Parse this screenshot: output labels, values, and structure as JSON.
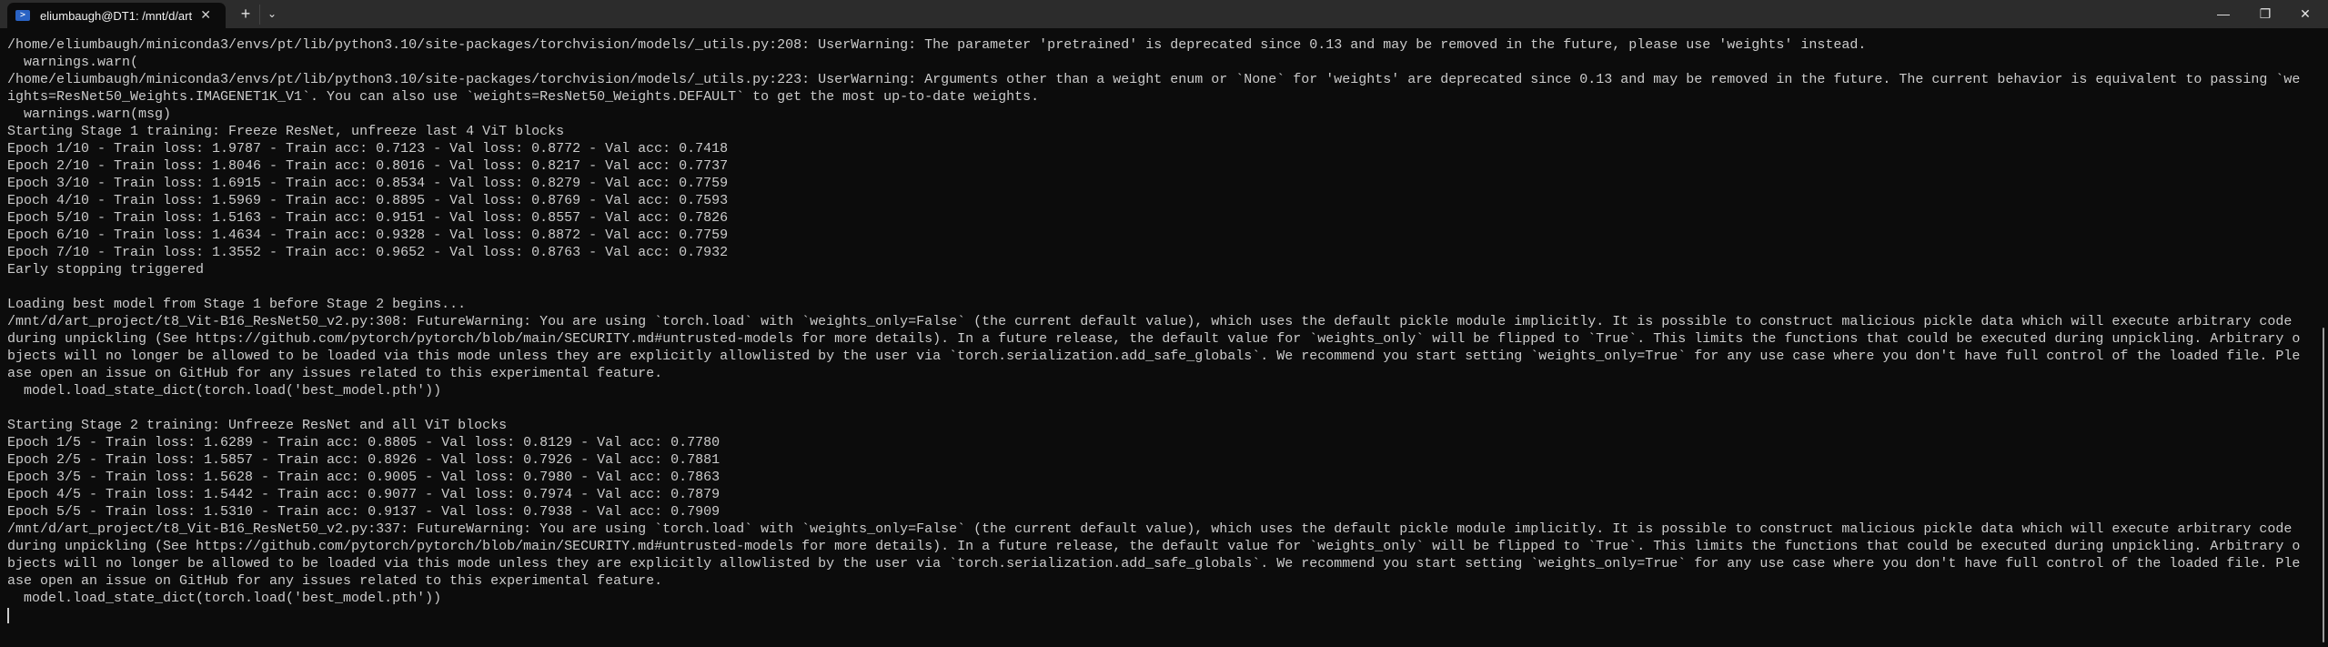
{
  "window": {
    "tab_title": "eliumbaugh@DT1: /mnt/d/art",
    "tab_icon": "powershell-icon",
    "new_tab_label": "+",
    "dropdown_label": "⌄",
    "minimize_label": "—",
    "maximize_label": "❐",
    "close_label": "✕",
    "tab_close_label": "✕"
  },
  "terminal": {
    "lines": [
      "/home/eliumbaugh/miniconda3/envs/pt/lib/python3.10/site-packages/torchvision/models/_utils.py:208: UserWarning: The parameter 'pretrained' is deprecated since 0.13 and may be removed in the future, please use 'weights' instead.",
      "  warnings.warn(",
      "/home/eliumbaugh/miniconda3/envs/pt/lib/python3.10/site-packages/torchvision/models/_utils.py:223: UserWarning: Arguments other than a weight enum or `None` for 'weights' are deprecated since 0.13 and may be removed in the future. The current behavior is equivalent to passing `we",
      "ights=ResNet50_Weights.IMAGENET1K_V1`. You can also use `weights=ResNet50_Weights.DEFAULT` to get the most up-to-date weights.",
      "  warnings.warn(msg)",
      "Starting Stage 1 training: Freeze ResNet, unfreeze last 4 ViT blocks",
      "Epoch 1/10 - Train loss: 1.9787 - Train acc: 0.7123 - Val loss: 0.8772 - Val acc: 0.7418",
      "Epoch 2/10 - Train loss: 1.8046 - Train acc: 0.8016 - Val loss: 0.8217 - Val acc: 0.7737",
      "Epoch 3/10 - Train loss: 1.6915 - Train acc: 0.8534 - Val loss: 0.8279 - Val acc: 0.7759",
      "Epoch 4/10 - Train loss: 1.5969 - Train acc: 0.8895 - Val loss: 0.8769 - Val acc: 0.7593",
      "Epoch 5/10 - Train loss: 1.5163 - Train acc: 0.9151 - Val loss: 0.8557 - Val acc: 0.7826",
      "Epoch 6/10 - Train loss: 1.4634 - Train acc: 0.9328 - Val loss: 0.8872 - Val acc: 0.7759",
      "Epoch 7/10 - Train loss: 1.3552 - Train acc: 0.9652 - Val loss: 0.8763 - Val acc: 0.7932",
      "Early stopping triggered",
      "",
      "Loading best model from Stage 1 before Stage 2 begins...",
      "/mnt/d/art_project/t8_Vit-B16_ResNet50_v2.py:308: FutureWarning: You are using `torch.load` with `weights_only=False` (the current default value), which uses the default pickle module implicitly. It is possible to construct malicious pickle data which will execute arbitrary code",
      "during unpickling (See https://github.com/pytorch/pytorch/blob/main/SECURITY.md#untrusted-models for more details). In a future release, the default value for `weights_only` will be flipped to `True`. This limits the functions that could be executed during unpickling. Arbitrary o",
      "bjects will no longer be allowed to be loaded via this mode unless they are explicitly allowlisted by the user via `torch.serialization.add_safe_globals`. We recommend you start setting `weights_only=True` for any use case where you don't have full control of the loaded file. Ple",
      "ase open an issue on GitHub for any issues related to this experimental feature.",
      "  model.load_state_dict(torch.load('best_model.pth'))",
      "",
      "Starting Stage 2 training: Unfreeze ResNet and all ViT blocks",
      "Epoch 1/5 - Train loss: 1.6289 - Train acc: 0.8805 - Val loss: 0.8129 - Val acc: 0.7780",
      "Epoch 2/5 - Train loss: 1.5857 - Train acc: 0.8926 - Val loss: 0.7926 - Val acc: 0.7881",
      "Epoch 3/5 - Train loss: 1.5628 - Train acc: 0.9005 - Val loss: 0.7980 - Val acc: 0.7863",
      "Epoch 4/5 - Train loss: 1.5442 - Train acc: 0.9077 - Val loss: 0.7974 - Val acc: 0.7879",
      "Epoch 5/5 - Train loss: 1.5310 - Train acc: 0.9137 - Val loss: 0.7938 - Val acc: 0.7909",
      "/mnt/d/art_project/t8_Vit-B16_ResNet50_v2.py:337: FutureWarning: You are using `torch.load` with `weights_only=False` (the current default value), which uses the default pickle module implicitly. It is possible to construct malicious pickle data which will execute arbitrary code",
      "during unpickling (See https://github.com/pytorch/pytorch/blob/main/SECURITY.md#untrusted-models for more details). In a future release, the default value for `weights_only` will be flipped to `True`. This limits the functions that could be executed during unpickling. Arbitrary o",
      "bjects will no longer be allowed to be loaded via this mode unless they are explicitly allowlisted by the user via `torch.serialization.add_safe_globals`. We recommend you start setting `weights_only=True` for any use case where you don't have full control of the loaded file. Ple",
      "ase open an issue on GitHub for any issues related to this experimental feature.",
      "  model.load_state_dict(torch.load('best_model.pth'))"
    ]
  }
}
